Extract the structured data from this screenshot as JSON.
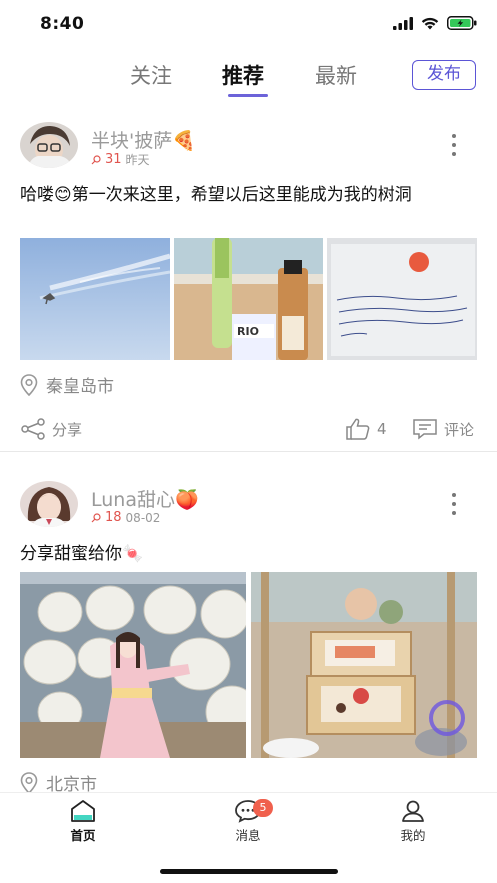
{
  "status_bar": {
    "time": "8:40",
    "battery_color": "#34c759"
  },
  "top_nav": {
    "tabs": [
      {
        "label": "关注",
        "active": false
      },
      {
        "label": "推荐",
        "active": true
      },
      {
        "label": "最新",
        "active": false
      }
    ],
    "publish_label": "发布",
    "accent": "#5b55d6"
  },
  "posts": [
    {
      "author": "半块'披萨",
      "author_emoji": "🍕",
      "heat": "31",
      "time": "昨天",
      "text": "哈喽😊第一次来这里，希望以后这里能成为我的树洞",
      "location": "秦皇岛市",
      "share_label": "分享",
      "like_count": "4",
      "comment_label": "评论",
      "photos": [
        "sky-with-bird",
        "drinks-on-beach",
        "handwritten-note"
      ],
      "note_text": "将会走走我要你你，不是要是一个干不下去，我要我的好好的事情给你了关系"
    },
    {
      "author": "Luna甜心",
      "author_emoji": "🍑",
      "heat": "18",
      "time": "08-02",
      "text": "分享甜蜜给你🍬",
      "location": "北京市",
      "photos": [
        "kimono-girl-lanterns",
        "sweets-display-box"
      ]
    }
  ],
  "bottom_nav": {
    "items": [
      {
        "label": "首页",
        "icon": "home-icon",
        "active": true
      },
      {
        "label": "消息",
        "icon": "message-icon",
        "active": false,
        "badge": "5"
      },
      {
        "label": "我的",
        "icon": "profile-icon",
        "active": false
      }
    ]
  }
}
